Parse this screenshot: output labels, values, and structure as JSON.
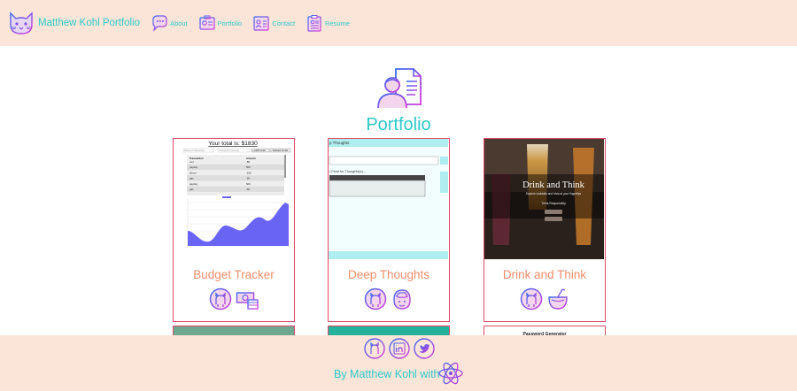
{
  "header": {
    "brand": {
      "label": "Matthew Kohl Portfolio",
      "icon": "cat-logo-icon"
    },
    "nav": [
      {
        "label": "About",
        "icon": "thought-bubble-icon"
      },
      {
        "label": "Portfolio",
        "icon": "portfolio-id-card-icon"
      },
      {
        "label": "Contact",
        "icon": "contact-card-icon"
      },
      {
        "label": "Resume",
        "icon": "resume-clipboard-icon"
      }
    ]
  },
  "main": {
    "title": "Portfolio",
    "hero_icon": "person-document-icon"
  },
  "projects": [
    {
      "title": "Budget Tracker",
      "icons": [
        "github-icon",
        "money-stack-icon"
      ],
      "thumb": {
        "heading": "Your total is: $1830",
        "input_placeholder": "Name of transaction",
        "amount_placeholder": "Transaction amount",
        "add_label": "+ Add Funds",
        "sub_label": "- Subtract Funds",
        "table_headers": [
          "Transaction",
          "Amount"
        ],
        "rows": [
          [
            "rent",
            "-80"
          ],
          [
            "payday",
            "500"
          ],
          [
            "dinner",
            "-150"
          ],
          [
            "gas",
            "-50"
          ],
          [
            "payday",
            "500"
          ],
          [
            "gas",
            "-50"
          ]
        ]
      }
    },
    {
      "title": "Deep Thoughts",
      "icons": [
        "github-icon",
        "brain-head-icon"
      ],
      "thumb": {
        "top_label": "p Thoughts",
        "feed_label": "r Feed for Thoughts(s)..."
      }
    },
    {
      "title": "Drink and Think",
      "icons": [
        "github-icon",
        "coconut-drink-icon"
      ],
      "thumb": {
        "heading": "Drink and Think",
        "sub": "Explore cocktails and trivia at your fingertips",
        "note": "Think Responsibly"
      }
    }
  ],
  "next_row": {
    "right_title": "Password Generator"
  },
  "footer": {
    "social": [
      "github-icon",
      "linkedin-icon",
      "twitter-icon"
    ],
    "byline": "By Matthew Kohl with",
    "tech_icon": "react-atom-icon"
  },
  "colors": {
    "teal": "#2dc9c9",
    "peach": "#fbe5d8",
    "coral": "#f08e6b",
    "border": "#e04a6a",
    "icon_gradient_start": "#3a6cf0",
    "icon_gradient_end": "#d33ad9"
  }
}
